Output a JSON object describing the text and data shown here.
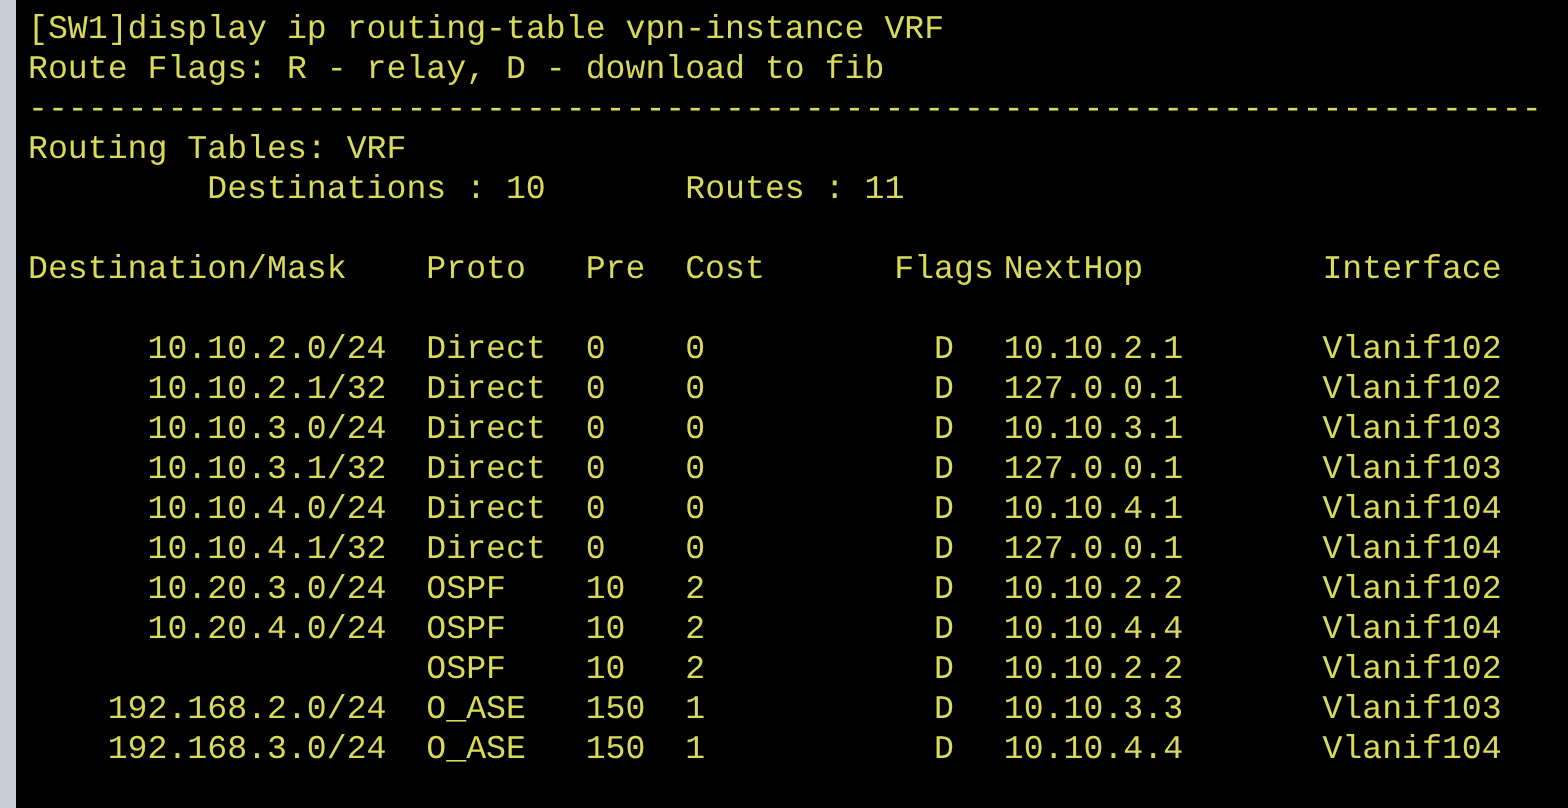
{
  "terminal": {
    "command": "[SW1]display ip routing-table vpn-instance VRF",
    "flags_legend": "Route Flags: R - relay, D - download to fib",
    "separator": "----------------------------------------------------------------------------",
    "table_title": "Routing Tables: VRF",
    "summary": [
      "Destinations : 10",
      "Routes : 11"
    ],
    "columns": [
      "Destination/Mask",
      "Proto",
      "Pre",
      "Cost",
      "Flags",
      "NextHop",
      "Interface"
    ],
    "rows": [
      {
        "destination": "10.10.2.0/24",
        "proto": "Direct",
        "pre": "0",
        "cost": "0",
        "flags": "D",
        "nexthop": "10.10.2.1",
        "interface": "Vlanif102"
      },
      {
        "destination": "10.10.2.1/32",
        "proto": "Direct",
        "pre": "0",
        "cost": "0",
        "flags": "D",
        "nexthop": "127.0.0.1",
        "interface": "Vlanif102"
      },
      {
        "destination": "10.10.3.0/24",
        "proto": "Direct",
        "pre": "0",
        "cost": "0",
        "flags": "D",
        "nexthop": "10.10.3.1",
        "interface": "Vlanif103"
      },
      {
        "destination": "10.10.3.1/32",
        "proto": "Direct",
        "pre": "0",
        "cost": "0",
        "flags": "D",
        "nexthop": "127.0.0.1",
        "interface": "Vlanif103"
      },
      {
        "destination": "10.10.4.0/24",
        "proto": "Direct",
        "pre": "0",
        "cost": "0",
        "flags": "D",
        "nexthop": "10.10.4.1",
        "interface": "Vlanif104"
      },
      {
        "destination": "10.10.4.1/32",
        "proto": "Direct",
        "pre": "0",
        "cost": "0",
        "flags": "D",
        "nexthop": "127.0.0.1",
        "interface": "Vlanif104"
      },
      {
        "destination": "10.20.3.0/24",
        "proto": "OSPF",
        "pre": "10",
        "cost": "2",
        "flags": "D",
        "nexthop": "10.10.2.2",
        "interface": "Vlanif102"
      },
      {
        "destination": "10.20.4.0/24",
        "proto": "OSPF",
        "pre": "10",
        "cost": "2",
        "flags": "D",
        "nexthop": "10.10.4.4",
        "interface": "Vlanif104"
      },
      {
        "proto": "OSPF",
        "pre": "10",
        "cost": "2",
        "flags": "D",
        "nexthop": "10.10.2.2",
        "interface": "Vlanif102"
      },
      {
        "destination": "192.168.2.0/24",
        "proto": "O_ASE",
        "pre": "150",
        "cost": "1",
        "flags": "D",
        "nexthop": "10.10.3.3",
        "interface": "Vlanif103"
      },
      {
        "destination": "192.168.3.0/24",
        "proto": "O_ASE",
        "pre": "150",
        "cost": "1",
        "flags": "D",
        "nexthop": "10.10.4.4",
        "interface": "Vlanif104"
      }
    ]
  }
}
